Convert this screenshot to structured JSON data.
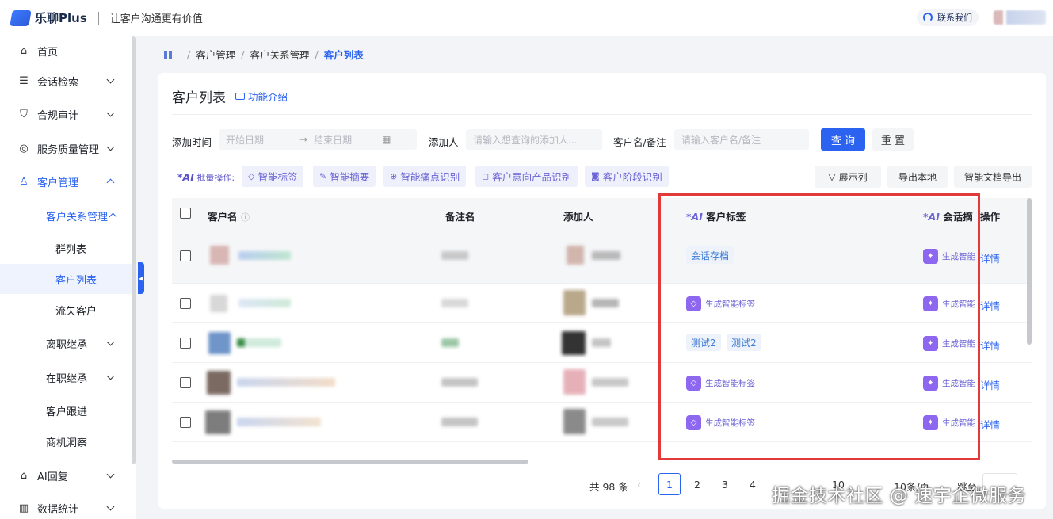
{
  "header": {
    "logo_text": "乐聊Plus",
    "slogan": "让客户沟通更有价值",
    "contact": "联系我们"
  },
  "sidebar": {
    "items": [
      {
        "label": "首页",
        "icon": "home-icon"
      },
      {
        "label": "会话检索",
        "icon": "chat-search-icon"
      },
      {
        "label": "合规审计",
        "icon": "shield-icon"
      },
      {
        "label": "服务质量管理",
        "icon": "service-quality-icon"
      },
      {
        "label": "客户管理",
        "icon": "user-icon"
      },
      {
        "label": "客户关系管理"
      },
      {
        "label": "群列表"
      },
      {
        "label": "客户列表"
      },
      {
        "label": "流失客户"
      },
      {
        "label": "离职继承"
      },
      {
        "label": "在职继承"
      },
      {
        "label": "客户跟进"
      },
      {
        "label": "商机洞察"
      },
      {
        "label": "AI回复",
        "icon": "robot-icon"
      },
      {
        "label": "数据统计",
        "icon": "bar-chart-icon"
      }
    ]
  },
  "breadcrumb": {
    "items": [
      "客户管理",
      "客户关系管理"
    ],
    "current": "客户列表"
  },
  "page": {
    "title": "客户列表",
    "intro_link": "功能介绍"
  },
  "filters": {
    "add_time_label": "添加时间",
    "start_placeholder": "开始日期",
    "end_placeholder": "结束日期",
    "adder_label": "添加人",
    "adder_placeholder": "请输入想查询的添加人...",
    "name_label": "客户名/备注",
    "name_placeholder": "请输入客户名/备注",
    "query": "查 询",
    "reset": "重 置"
  },
  "ai_bar": {
    "prefix": "*AI",
    "label": "批量操作:",
    "buttons": [
      "智能标签",
      "智能摘要",
      "智能痛点识别",
      "客户意向产品识别",
      "客户阶段识别"
    ]
  },
  "toolbar": {
    "show_columns": "展示列",
    "export_local": "导出本地",
    "export_doc": "智能文档导出"
  },
  "table": {
    "headers": {
      "name": "客户名",
      "remark": "备注名",
      "adder": "添加人",
      "ai_prefix": "*AI",
      "tags": "客户标签",
      "summary": "会话摘",
      "action": "操作"
    },
    "rows": [
      {
        "tags": [
          "会话存档"
        ],
        "summary": "生成智能",
        "action": "详情"
      },
      {
        "gen_tag": "生成智能标签",
        "summary": "生成智能",
        "action": "详情"
      },
      {
        "tags": [
          "测试2",
          "测试2"
        ],
        "summary": "生成智能",
        "action": "详情"
      },
      {
        "gen_tag": "生成智能标签",
        "summary": "生成智能",
        "action": "详情"
      },
      {
        "gen_tag": "生成智能标签",
        "summary": "生成智能",
        "action": "详情"
      }
    ]
  },
  "pagination": {
    "total": "共 98 条",
    "pages": [
      "1",
      "2",
      "3",
      "4"
    ],
    "last": "10",
    "size": "10条/页",
    "jump": "跳至"
  },
  "watermark": "掘金技术社区 @ 速宇企微服务"
}
